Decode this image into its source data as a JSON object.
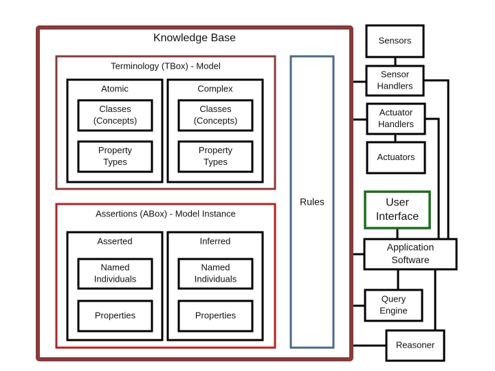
{
  "colors": {
    "kb_border": "#8b3a3a",
    "tbox_border": "#8b3a3a",
    "abox_border": "#b22222",
    "rules_border": "#4a6a8a",
    "ui_border": "#1e6b1e",
    "box_border": "#000000"
  },
  "knowledge_base": {
    "title": "Knowledge Base",
    "tbox": {
      "title": "Terminology (TBox) - Model",
      "columns": [
        {
          "title": "Atomic",
          "items": [
            [
              "Classes",
              "(Concepts)"
            ],
            [
              "Property",
              "Types"
            ]
          ]
        },
        {
          "title": "Complex",
          "items": [
            [
              "Classes",
              "(Concepts)"
            ],
            [
              "Property",
              "Types"
            ]
          ]
        }
      ]
    },
    "abox": {
      "title": "Assertions (ABox) - Model Instance",
      "columns": [
        {
          "title": "Asserted",
          "items": [
            [
              "Named",
              "Individuals"
            ],
            [
              "Properties"
            ]
          ]
        },
        {
          "title": "Inferred",
          "items": [
            [
              "Named",
              "Individuals"
            ],
            [
              "Properties"
            ]
          ]
        }
      ]
    },
    "rules": "Rules"
  },
  "components": {
    "sensors": [
      "Sensors"
    ],
    "sensor_handlers": [
      "Sensor",
      "Handlers"
    ],
    "actuator_handlers": [
      "Actuator",
      "Handlers"
    ],
    "actuators": [
      "Actuators"
    ],
    "user_interface": [
      "User",
      "Interface"
    ],
    "application_software": [
      "Application",
      "Software"
    ],
    "query_engine": [
      "Query",
      "Engine"
    ],
    "reasoner": [
      "Reasoner"
    ]
  }
}
